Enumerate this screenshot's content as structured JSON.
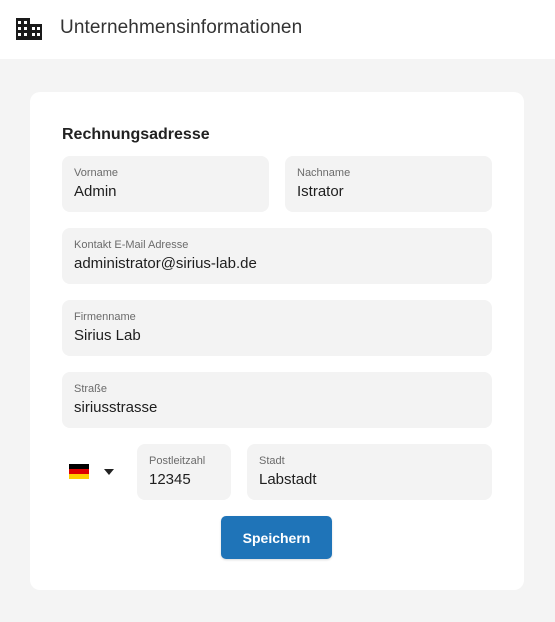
{
  "header": {
    "title": "Unternehmensinformationen",
    "icon": "building-icon"
  },
  "section": {
    "title": "Rechnungsadresse"
  },
  "fields": {
    "vorname": {
      "label": "Vorname",
      "value": "Admin"
    },
    "nachname": {
      "label": "Nachname",
      "value": "Istrator"
    },
    "email": {
      "label": "Kontakt E-Mail Adresse",
      "value": "administrator@sirius-lab.de"
    },
    "firma": {
      "label": "Firmenname",
      "value": "Sirius Lab"
    },
    "strasse": {
      "label": "Straße",
      "value": "siriusstrasse"
    },
    "plz": {
      "label": "Postleitzahl",
      "value": "12345"
    },
    "stadt": {
      "label": "Stadt",
      "value": "Labstadt"
    }
  },
  "country_select": {
    "flag": "germany-flag-icon",
    "colors": [
      "#000000",
      "#dd0000",
      "#ffce00"
    ]
  },
  "actions": {
    "save_label": "Speichern",
    "save_color": "#1f74b8"
  }
}
